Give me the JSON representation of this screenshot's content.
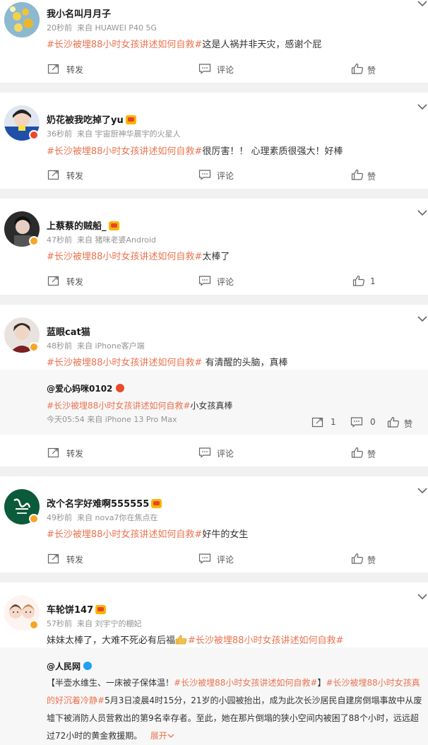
{
  "actions": {
    "repost": "转发",
    "comment": "评论",
    "like": "赞"
  },
  "comments": [
    {
      "name": "我小名叫月月子",
      "time": "20秒前",
      "source": "来自 HUAWEI P40 5G",
      "tag": "#长沙被埋88小时女孩讲述如何自救#",
      "text": "这是人祸并非天灾，感谢个屁",
      "like": "赞"
    },
    {
      "name": "奶花被我吃掉了yu",
      "time": "36秒前",
      "source": "来自 宇宙厨神华晨宇的火星人",
      "tag": "#长沙被埋88小时女孩讲述如何自救#",
      "text": "很厉害！！ 心理素质很强大！好棒",
      "like": "赞"
    },
    {
      "name": "上蔡蔡的贼船_",
      "time": "47秒前",
      "source": "来自 猪咪老婆Android",
      "tag": "#长沙被埋88小时女孩讲述如何自救#",
      "text": "太棒了",
      "like": "1"
    },
    {
      "name": "蓝眼cat猫",
      "time": "48秒前",
      "source": "来自 iPhone客户端",
      "tag": "#长沙被埋88小时女孩讲述如何自救#",
      "text": " 有清醒的头脑，真棒",
      "like": "赞"
    },
    {
      "name": "改个名字好难啊555555",
      "time": "49秒前",
      "source": "来自 nova7你在焦点在",
      "tag": "#长沙被埋88小时女孩讲述如何自救#",
      "text": "好牛的女生",
      "like": "赞"
    },
    {
      "name": "车轮饼147",
      "time": "57秒前",
      "source": "来自 刘宇宁的棚妃",
      "text": "妹妹太棒了，大难不死必有后福",
      "tag": "#长沙被埋88小时女孩讲述如何自救#"
    }
  ],
  "quote1": {
    "name": "@爱心妈咪0102",
    "tag": "#长沙被埋88小时女孩讲述如何自救#",
    "text": "小女孩真棒",
    "meta": "今天05:54 来自 iPhone 13 Pro Max",
    "repost_count": "1",
    "comment_count": "0",
    "like": "赞"
  },
  "quote2": {
    "name": "@人民网",
    "p1": "【半壶水维生、一床被子保体温！",
    "tag1": "#长沙被埋88小时女孩讲述如何自救#",
    "p2": "】",
    "tag2a": "#长沙被埋88小时女孩真",
    "tag2b": "的好沉着冷静#",
    "p3": "5月3日凌晨4时15分，21岁的小园被抬出，成为此次长沙居民自建房倒塌事故中从废",
    "p4": "墟下被消防人员营救出的第9名幸存者。至此，她在那片倒塌的狭小空间内被困了88个小时，远远超",
    "p5": "过72小时的黄金救援期。",
    "expand": "展开"
  },
  "colors": {
    "accent": "#eb7350",
    "meta": "#939393",
    "gap": "#f1f1f1",
    "quote_bg": "#f7f7f7",
    "verified_orange": "#f5a623",
    "verified_red": "#e94a2b",
    "verified_blue": "#1da1f2"
  },
  "icons": [
    "chevron-down-icon",
    "repost-icon",
    "comment-icon",
    "like-icon",
    "verified-badge-icon",
    "vip-badge-icon",
    "thumbs-up-emoji-icon"
  ]
}
